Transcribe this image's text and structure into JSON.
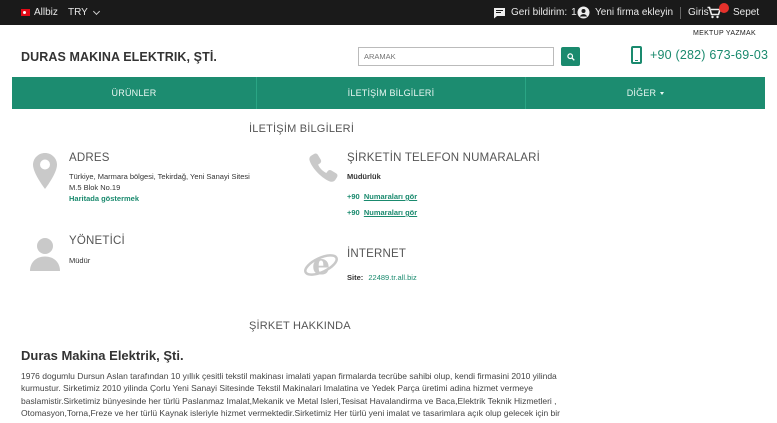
{
  "topbar": {
    "site_label": "Allbiz",
    "currency": "TRY",
    "feedback_label": "Geri bildirim:",
    "feedback_count": "1",
    "add_company": "Yeni firma ekleyin",
    "login": "Giris",
    "cart": "Sepet"
  },
  "header": {
    "write_letter": "MEKTUP YAZMAK",
    "company_name": "DURAS MAKINA ELEKTRIK, ŞTİ.",
    "search_placeholder": "ARAMAK",
    "phone": "+90 (282) 673-69-03"
  },
  "nav": {
    "tabs": [
      {
        "label": "ÜRÜNLER"
      },
      {
        "label": "İLETİŞİM BİLGİLERİ"
      },
      {
        "label": "DİĞER"
      }
    ]
  },
  "contact": {
    "section_title": "İLETİŞİM BİLGİLERİ",
    "address": {
      "title": "ADRES",
      "line1": "Türkiye,  Marmara bölgesi,  Tekirdağ,  Yeni Sanayi Sitesi",
      "line2": "M.5 Blok No.19",
      "map_link": "Haritada göstermek"
    },
    "phones": {
      "title": "ŞİRKETİN TELEFON NUMARALARİ",
      "role": "Müdürlük",
      "items": [
        {
          "prefix": "+90",
          "link": "Numaraları gör"
        },
        {
          "prefix": "+90",
          "link": "Numaraları gör"
        }
      ]
    },
    "manager": {
      "title": "YÖNETİCİ",
      "role": "Müdür"
    },
    "internet": {
      "title": "İNTERNET",
      "site_label": "Site:",
      "site_url": "22489.tr.all.biz"
    }
  },
  "about": {
    "section_title": "ŞİRKET HAKKINDA",
    "company_name": "Duras Makina Elektrik, Şti.",
    "text": "1976 dogumlu Dursun Aslan tarafından 10 yıllık çesitli tekstil makinası imalati yapan firmalarda tecrübe sahibi olup, kendi firmasini 2010 yilinda kurmustur. Sirketimiz 2010 yilinda Çorlu Yeni Sanayi Sitesinde Tekstil Makinalari Imalatina ve Yedek Parça üretimi adina hizmet vermeye baslamistir.Sirketimiz bünyesinde her türlü Paslanmaz Imalat,Mekanik ve Metal Isleri,Tesisat Havalandirma ve Baca,Elektrik Teknik Hizmetleri , Otomasyon,Torna,Freze ve her türlü Kaynak isleriyle hizmet vermektedir.Sirketimiz Her türlü yeni imalat ve tasarimlara açık olup gelecek için bir vizyon olusturmayi hedeflemektedir."
  },
  "colors": {
    "brand": "#1c8c70",
    "topbar": "#1a1a1a",
    "badge": "#e5312b"
  }
}
